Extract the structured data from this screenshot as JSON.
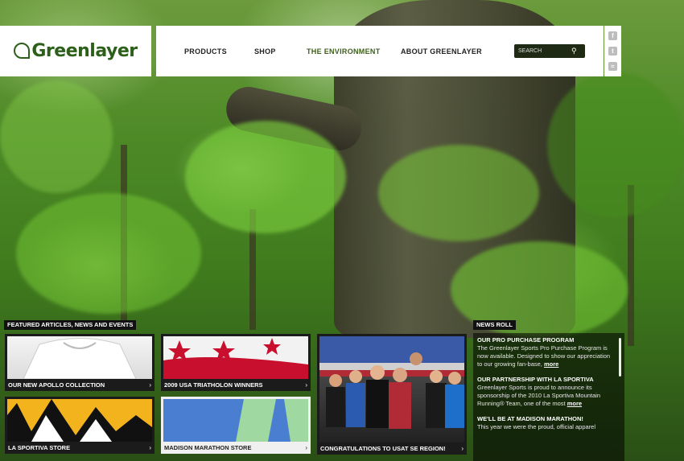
{
  "brand": {
    "logo_text": "Greenlayer"
  },
  "nav": {
    "items": [
      {
        "label": "PRODUCTS"
      },
      {
        "label": "SHOP"
      },
      {
        "label": "THE ENVIRONMENT"
      },
      {
        "label": "ABOUT  GREENLAYER"
      }
    ]
  },
  "search": {
    "placeholder": "SEARCH",
    "icon": "search-icon"
  },
  "social": [
    {
      "icon": "facebook-icon",
      "glyph": "f"
    },
    {
      "icon": "twitter-icon",
      "glyph": "t"
    },
    {
      "icon": "rss-icon",
      "glyph": "≈"
    }
  ],
  "featured": {
    "label": "FEATURED ARTICLES, NEWS AND EVENTS",
    "cards": [
      {
        "caption": "OUR NEW APOLLO COLLECTION"
      },
      {
        "caption": "2009 USA TRIATHOLON WINNERS"
      },
      {
        "caption": "CONGRATULATIONS TO USAT SE REGION!"
      },
      {
        "caption": "LA SPORTIVA STORE"
      },
      {
        "caption": "MADISON MARATHON STORE"
      }
    ]
  },
  "news_roll": {
    "label": "NEWS ROLL",
    "items": [
      {
        "title": "OUR PRO PURCHASE  PROGRAM",
        "body": "The Greenlayer Sports Pro Purchase Program is now available.  Designed to show our appreciation to our growing fan-base, ",
        "more": "more"
      },
      {
        "title": "OUR PARTNERSHIP WITH LA SPORTIVA",
        "body": "Greenlayer Sports is proud to announce its sponsorship of the 2010 La Sportiva Mountain Running® Team, one of the most ",
        "more": "more"
      },
      {
        "title": "WE'LL BE AT MADISON MARATHON!",
        "body": "This year we were the proud, official apparel",
        "more": ""
      }
    ]
  },
  "colors": {
    "brand_green": "#2c5f1a",
    "env_green": "#3e5f1b",
    "dark": "#1b1b1b"
  }
}
